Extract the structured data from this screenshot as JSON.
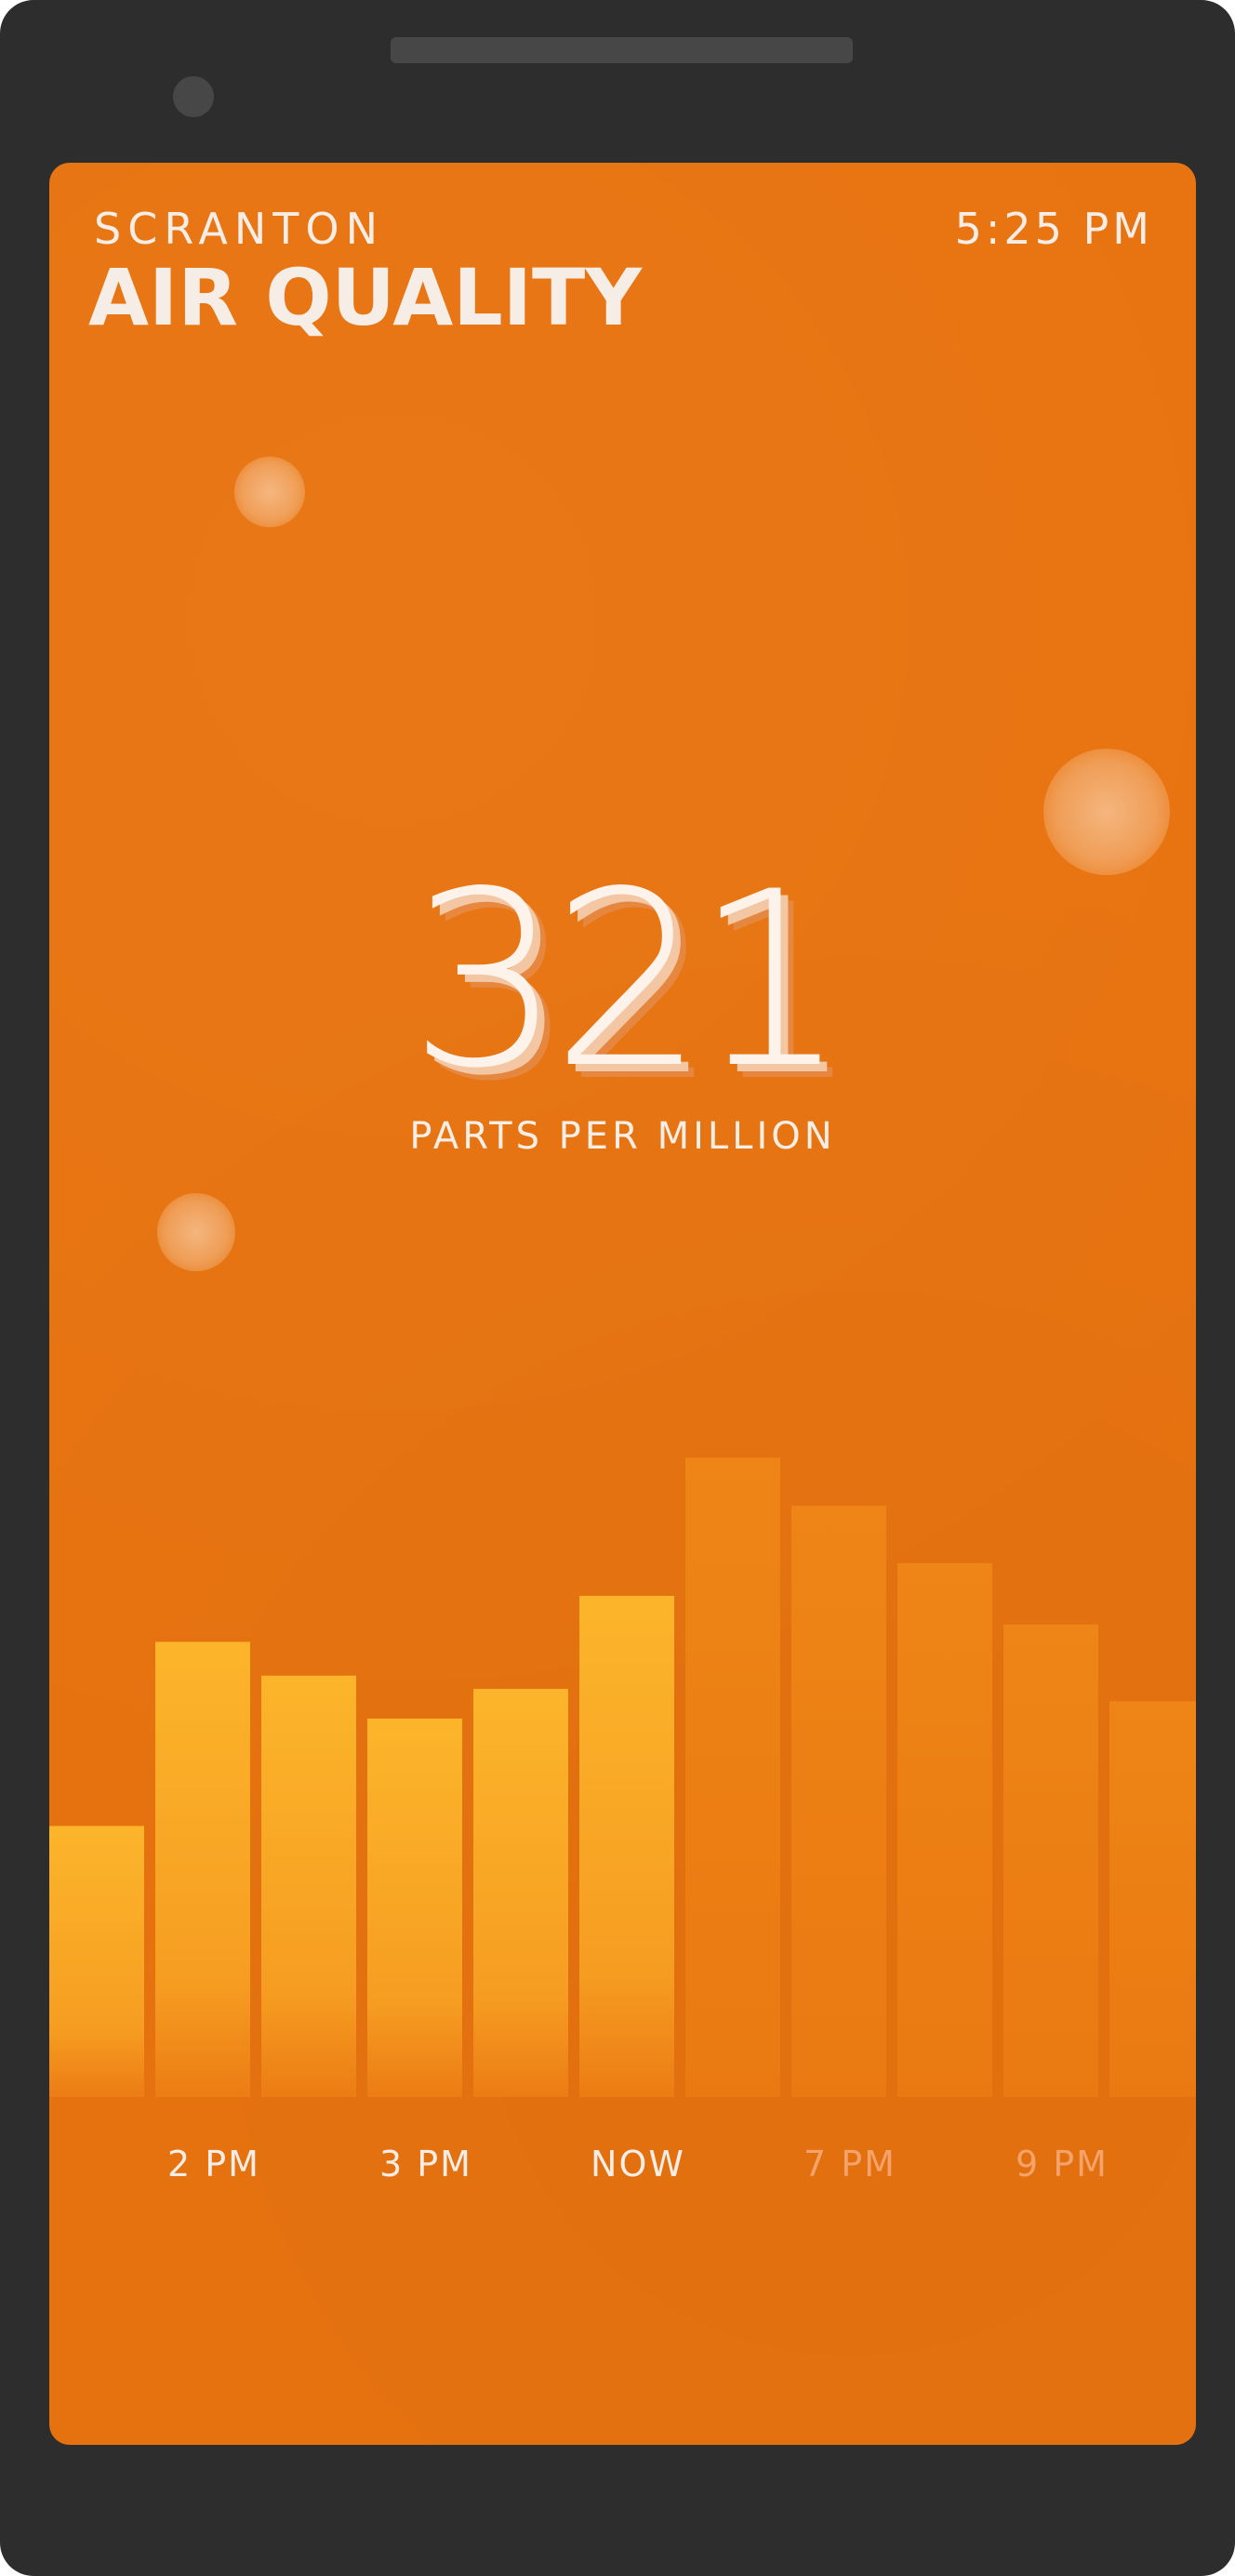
{
  "header": {
    "city": "SCRANTON",
    "title": "AIR QUALITY",
    "time": "5:25 PM"
  },
  "reading": {
    "value": "321",
    "unit": "PARTS PER MILLION"
  },
  "colors": {
    "screen_bg": "#e8730f",
    "past_bar_top": "#fbb32a",
    "past_bar_bottom": "#ef8a18",
    "future_bar": "#ee8315",
    "text": "#f6ede6",
    "future_label": "#f5a36a"
  },
  "chart_data": {
    "type": "bar",
    "bars": [
      {
        "value": 265,
        "period": "past"
      },
      {
        "value": 445,
        "period": "past"
      },
      {
        "value": 412,
        "period": "past"
      },
      {
        "value": 370,
        "period": "past"
      },
      {
        "value": 399,
        "period": "past"
      },
      {
        "value": 490,
        "period": "past"
      },
      {
        "value": 625,
        "period": "future"
      },
      {
        "value": 578,
        "period": "future"
      },
      {
        "value": 522,
        "period": "future"
      },
      {
        "value": 462,
        "period": "future"
      },
      {
        "value": 387,
        "period": "future"
      }
    ],
    "tick_labels": [
      {
        "label": "2 PM",
        "bar_index": 1,
        "emphasis": "current"
      },
      {
        "label": "3 PM",
        "bar_index": 3,
        "emphasis": "current"
      },
      {
        "label": "NOW",
        "bar_index": 5,
        "emphasis": "current"
      },
      {
        "label": "7 PM",
        "bar_index": 7,
        "emphasis": "future"
      },
      {
        "label": "9 PM",
        "bar_index": 9,
        "emphasis": "future"
      }
    ],
    "title": "",
    "xlabel": "",
    "ylabel": "",
    "grid": false,
    "legend": "none"
  }
}
